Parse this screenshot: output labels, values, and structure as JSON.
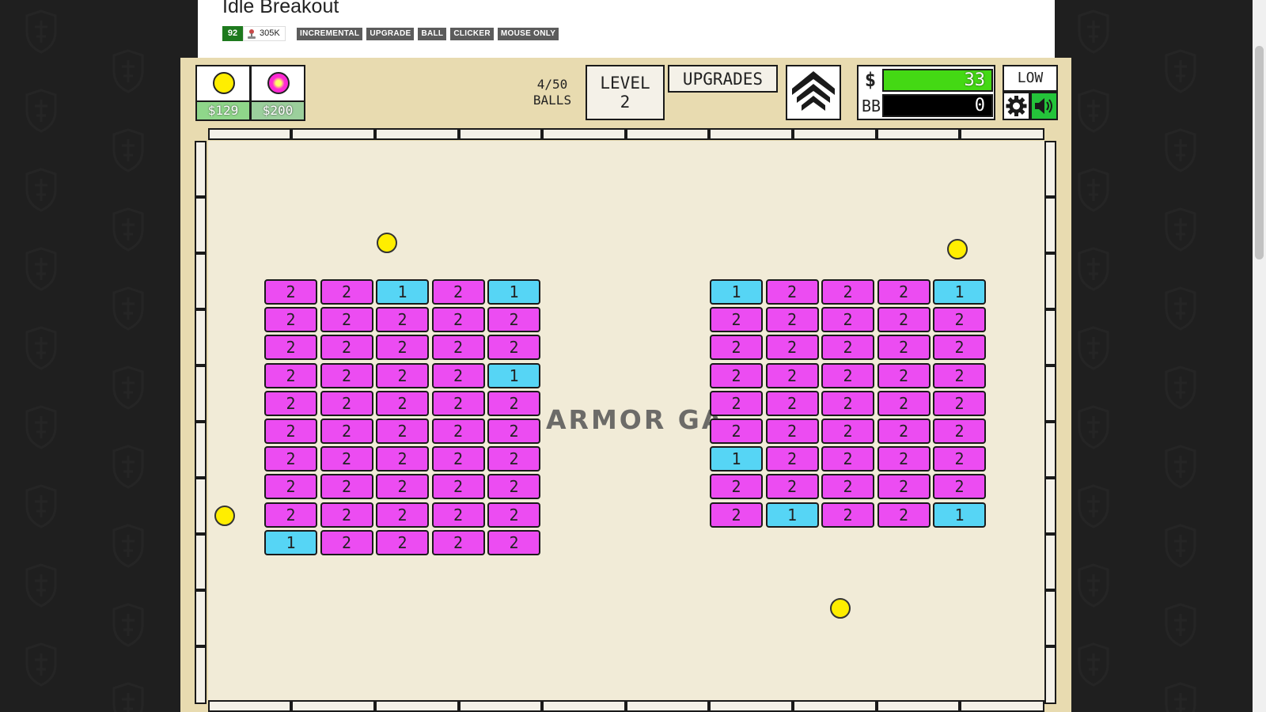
{
  "page": {
    "title": "Idle Breakout",
    "rating": "92",
    "plays": "305K",
    "tags": [
      "INCREMENTAL",
      "UPGRADE",
      "BALL",
      "CLICKER",
      "MOUSE ONLY"
    ]
  },
  "hud": {
    "shop": [
      {
        "ball": "yellow",
        "color": "#ffee00",
        "price": "$129"
      },
      {
        "ball": "magenta",
        "color": "#ff2ad4",
        "price": "$200"
      }
    ],
    "balls_count": "4/50",
    "balls_label": "BALLS",
    "level_label": "LEVEL",
    "level_value": "2",
    "upgrades_label": "UPGRADES",
    "money_symbol": "$",
    "money_value": "33",
    "bb_label": "BB",
    "bb_value": "0",
    "quality_label": "LOW"
  },
  "watermark": "ARMOR GA",
  "colors": {
    "brick_magenta": "#ec4cf2",
    "brick_cyan": "#56d5f5",
    "ball_yellow": "#ffee00",
    "money_green": "#44d914",
    "sound_green": "#24c43a",
    "game_frame": "#e8dbb0",
    "arena": "#f1ebd7"
  },
  "bricks_left": [
    [
      "2",
      "2",
      "1",
      "2",
      "1"
    ],
    [
      "2",
      "2",
      "2",
      "2",
      "2"
    ],
    [
      "2",
      "2",
      "2",
      "2",
      "2"
    ],
    [
      "2",
      "2",
      "2",
      "2",
      "1"
    ],
    [
      "2",
      "2",
      "2",
      "2",
      "2"
    ],
    [
      "2",
      "2",
      "2",
      "2",
      "2"
    ],
    [
      "2",
      "2",
      "2",
      "2",
      "2"
    ],
    [
      "2",
      "2",
      "2",
      "2",
      "2"
    ],
    [
      "2",
      "2",
      "2",
      "2",
      "2"
    ],
    [
      "1",
      "2",
      "2",
      "2",
      "2"
    ]
  ],
  "bricks_right": [
    [
      "1",
      "2",
      "2",
      "2",
      "1"
    ],
    [
      "2",
      "2",
      "2",
      "2",
      "2"
    ],
    [
      "2",
      "2",
      "2",
      "2",
      "2"
    ],
    [
      "2",
      "2",
      "2",
      "2",
      "2"
    ],
    [
      "2",
      "2",
      "2",
      "2",
      "2"
    ],
    [
      "2",
      "2",
      "2",
      "2",
      "2"
    ],
    [
      "1",
      "2",
      "2",
      "2",
      "2"
    ],
    [
      "2",
      "2",
      "2",
      "2",
      "2"
    ],
    [
      "2",
      "1",
      "2",
      "2",
      "1"
    ]
  ]
}
